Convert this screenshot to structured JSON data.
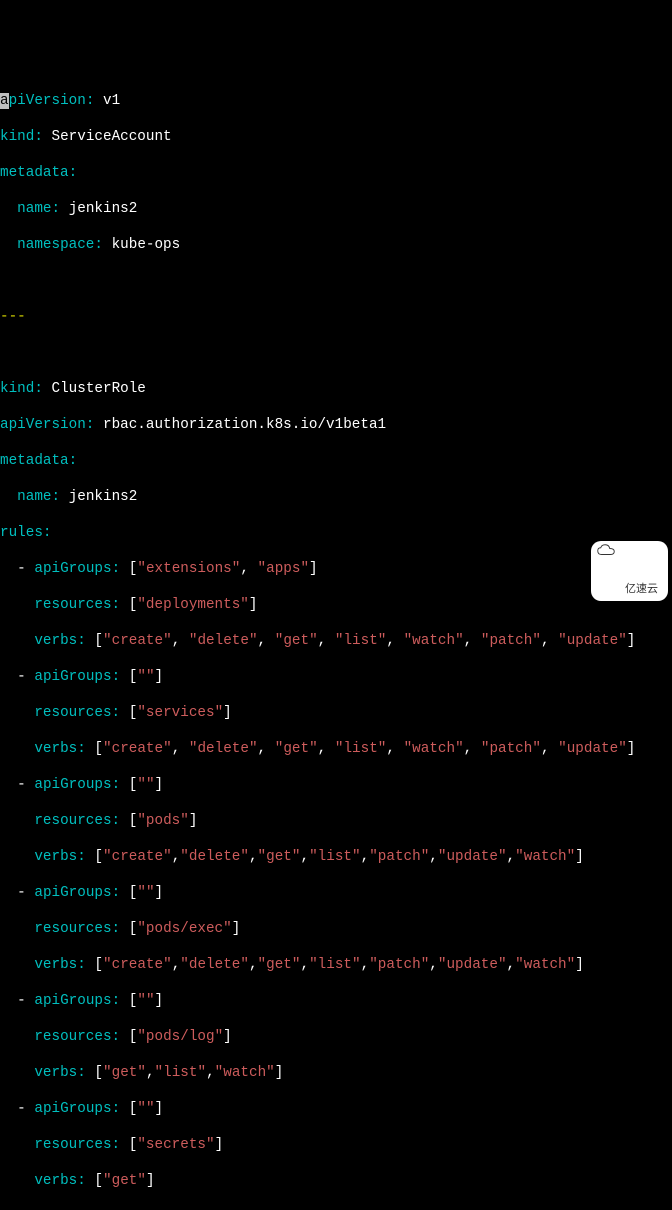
{
  "doc1": {
    "apiVersion": "v1",
    "kind": "ServiceAccount",
    "metadata_name": "jenkins2",
    "metadata_namespace": "kube-ops"
  },
  "separator": "---",
  "doc2": {
    "kind": "ClusterRole",
    "apiVersion": "rbac.authorization.k8s.io/v1beta1",
    "metadata_name": "jenkins2",
    "rules": [
      {
        "apiGroups": [
          "extensions",
          "apps"
        ],
        "resources": [
          "deployments"
        ],
        "verbs": [
          "create",
          "delete",
          "get",
          "list",
          "watch",
          "patch",
          "update"
        ]
      },
      {
        "apiGroups": [
          ""
        ],
        "resources": [
          "services"
        ],
        "verbs": [
          "create",
          "delete",
          "get",
          "list",
          "watch",
          "patch",
          "update"
        ]
      },
      {
        "apiGroups": [
          ""
        ],
        "resources": [
          "pods"
        ],
        "verbs": [
          "create",
          "delete",
          "get",
          "list",
          "patch",
          "update",
          "watch"
        ]
      },
      {
        "apiGroups": [
          ""
        ],
        "resources": [
          "pods/exec"
        ],
        "verbs": [
          "create",
          "delete",
          "get",
          "list",
          "patch",
          "update",
          "watch"
        ]
      },
      {
        "apiGroups": [
          ""
        ],
        "resources": [
          "pods/log"
        ],
        "verbs": [
          "get",
          "list",
          "watch"
        ]
      },
      {
        "apiGroups": [
          ""
        ],
        "resources": [
          "secrets"
        ],
        "verbs": [
          "get"
        ]
      }
    ]
  },
  "keys": {
    "apiVersion": "apiVersion",
    "apiVersion_rest": "piVersion",
    "kind": "kind",
    "metadata": "metadata",
    "name": "name",
    "namespace": "namespace",
    "rules": "rules",
    "apiGroups": "apiGroups",
    "resources": "resources",
    "verbs": "verbs"
  },
  "punct": {
    "colon": ":",
    "dash": "-",
    "lb": "[",
    "rb": "]",
    "comma": ",",
    "q": "\"",
    "a_char": "a"
  },
  "watermark": "亿速云"
}
